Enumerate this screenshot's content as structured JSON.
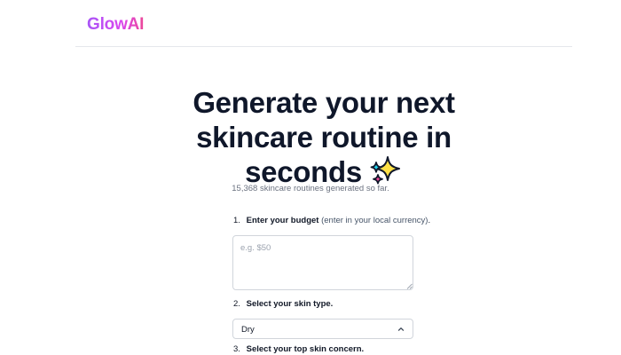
{
  "header": {
    "logo": "GlowAI"
  },
  "hero": {
    "title_line1": "Generate your next",
    "title_line2": "skincare routine in",
    "title_line3": "seconds",
    "subtitle": "15,368 skincare routines generated so far."
  },
  "form": {
    "step1": {
      "number": "1.",
      "label": "Enter your budget",
      "hint": "(enter in your local currency)",
      "suffix": ".",
      "placeholder": "e.g. $50",
      "value": ""
    },
    "step2": {
      "number": "2.",
      "label": "Select your skin type.",
      "selected": "Dry"
    },
    "step3": {
      "number": "3.",
      "label": "Select your top skin concern."
    }
  },
  "icons": {
    "sparkle": "sparkles-icon",
    "chevron": "chevron-up-down-icon"
  },
  "colors": {
    "brand_from": "#a855f7",
    "brand_to": "#ec4899",
    "sparkle_yellow": "#fde047",
    "sparkle_cyan": "#22d3ee",
    "sparkle_pink": "#ec4899"
  }
}
